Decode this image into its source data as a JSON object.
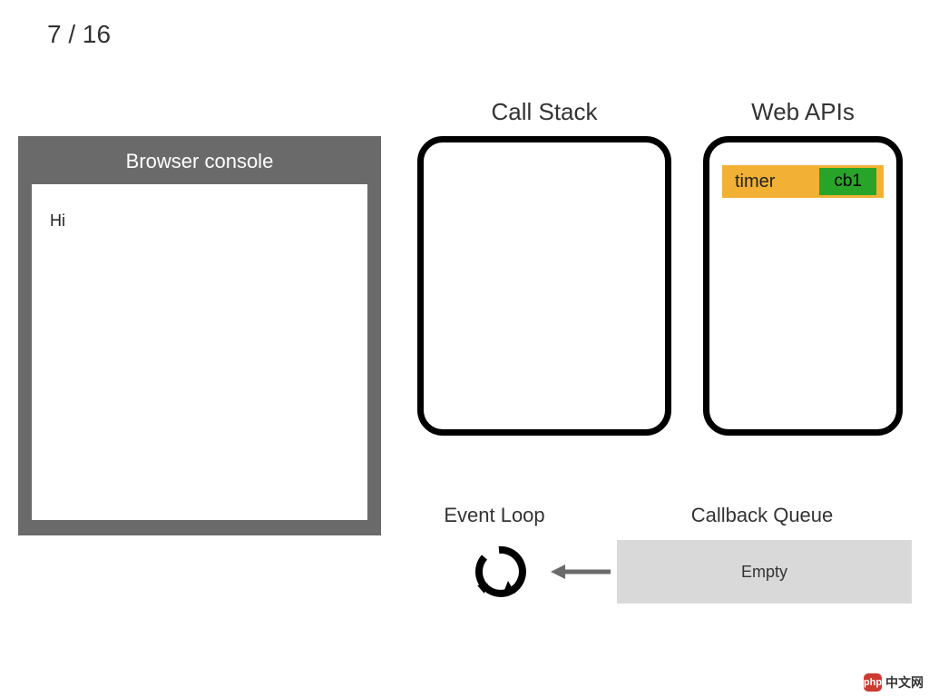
{
  "slide": {
    "counter": "7 / 16"
  },
  "console": {
    "title": "Browser console",
    "lines": [
      "Hi"
    ]
  },
  "callStack": {
    "title": "Call Stack"
  },
  "webApis": {
    "title": "Web APIs",
    "entries": [
      {
        "label": "timer",
        "callback": "cb1"
      }
    ]
  },
  "eventLoop": {
    "title": "Event Loop"
  },
  "callbackQueue": {
    "title": "Callback Queue",
    "status": "Empty"
  },
  "watermark": {
    "brand": "php",
    "text": "中文网"
  }
}
